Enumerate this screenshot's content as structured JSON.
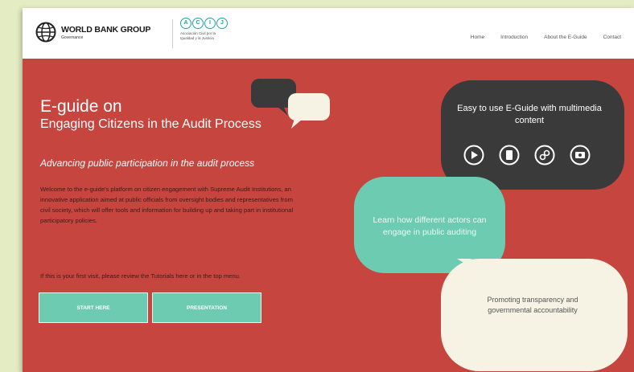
{
  "header": {
    "brand": "WORLD BANK GROUP",
    "brand_sub": "Governance",
    "partner_letters": [
      "A",
      "C",
      "I",
      "J"
    ],
    "partner_sub": "Asociación Civil por la Igualdad y la Justicia",
    "nav": [
      "Home",
      "Introduction",
      "About the E-Guide",
      "Contact"
    ]
  },
  "hero": {
    "title": "E-guide on",
    "subtitle": "Engaging Citizens in the Audit Process",
    "tagline": "Advancing public participation in the audit process",
    "body": "Welcome to the e-guide's platform on citizen engagement with Supreme Audit Institutions, an innovative application aimed at public officials from oversight bodies and representatives from civil society, which will offer tools and information for building up and taking part in institutional participatory policies.",
    "visit": "If this is your first visit, please review the Tutorials here or in the top menu.",
    "buttons": {
      "start": "START HERE",
      "presentation": "PRESENTATION"
    }
  },
  "bubbles": {
    "dark": "Easy to use E-Guide with multimedia content",
    "teal": "Learn how different actors can engage in public auditing",
    "cream": "Promoting transparency and governmental accountability"
  },
  "icons": [
    "play-icon",
    "document-icon",
    "link-icon",
    "photo-icon",
    "globe-icon"
  ],
  "colors": {
    "background": "#c6453e",
    "accent_teal": "#6ccbb1",
    "dark_bubble": "#3a3a3a",
    "cream_bubble": "#f6f3e4",
    "page_border": "#e3ecc3"
  }
}
